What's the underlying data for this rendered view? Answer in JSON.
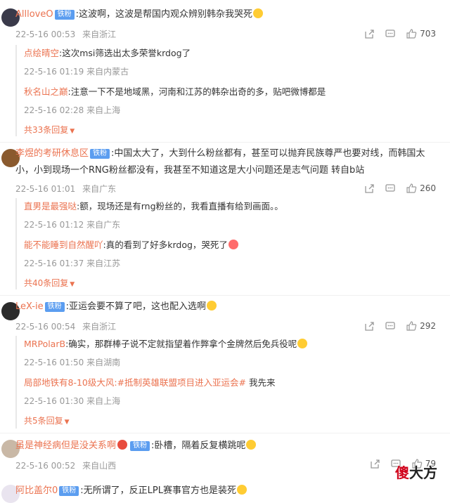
{
  "badge": "铁粉",
  "comments": [
    {
      "username": "AllloveO",
      "text": ":这波啊，这波是帮国内观众辨别韩杂我哭死",
      "time": "22-5-16 00:53",
      "location": "来自浙江",
      "likes": "703",
      "replies": [
        {
          "user": "点绘晴空",
          "text": ":这次msi筛选出太多荣誉krdog了",
          "time": "22-5-16 01:19",
          "location": "来自内蒙古"
        },
        {
          "user": "秋名山之巅",
          "text": ":注意一下不是地域黑，河南和江苏的韩杂出奇的多，贴吧微博都是",
          "time": "22-5-16 02:28",
          "location": "来自上海"
        }
      ],
      "more": "共33条回复"
    },
    {
      "username": "李煜的考研休息区",
      "text": ":中国太大了，大到什么粉丝都有，甚至可以抛弃民族尊严也要对线，而韩国太",
      "text2": "小，小到现场一个RNG粉丝都没有，我甚至不知道这是大小问题还是志气问题   转自b站",
      "time": "22-5-16 01:01",
      "location": "来自广东",
      "likes": "260",
      "replies": [
        {
          "user": "直男是最强哒",
          "text": ":额，现场还是有rng粉丝的，我看直播有给到画面。。",
          "time": "22-5-16 01:12",
          "location": "来自广东"
        },
        {
          "user": "能不能睡到自然醒吖",
          "text": ":真的看到了好多krdog，哭死了",
          "time": "22-5-16 01:37",
          "location": "来自江苏"
        }
      ],
      "more": "共40条回复"
    },
    {
      "username": "LeX-ie",
      "text": ":亚运会要不算了吧，这也配入选啊",
      "time": "22-5-16 00:54",
      "location": "来自浙江",
      "likes": "292",
      "replies": [
        {
          "user": "MRPolarB",
          "text": ":确实，那群棒子说不定就指望着作弊拿个金牌然后免兵役呢",
          "time": "22-5-16 01:50",
          "location": "来自湖南"
        },
        {
          "user": "局部地铁有8-10级大风",
          "text": ":#抵制英雄联盟项目进入亚运会#",
          "text_extra": " 我先来",
          "time": "22-5-16 01:30",
          "location": "来自上海"
        }
      ],
      "more": "共5条回复"
    },
    {
      "username": "虽是神经病但是没关系啊",
      "text": ":卧槽，隔着反复横跳呢",
      "time": "22-5-16 00:52",
      "location": "来自山西",
      "likes": "79"
    },
    {
      "username": "阿比盖尔0",
      "text": ":无所谓了，反正LPL赛事官方也是装死"
    }
  ],
  "watermark": {
    "part1": "傻",
    "part2": "大方"
  }
}
